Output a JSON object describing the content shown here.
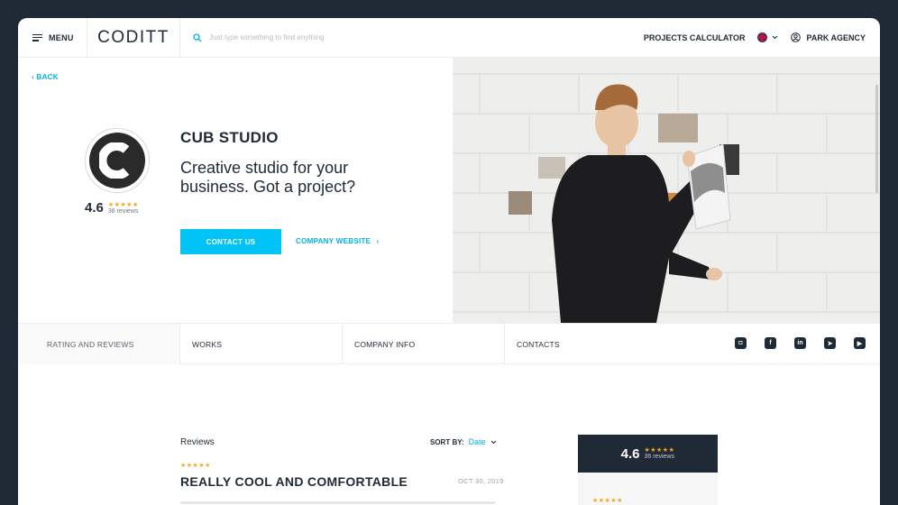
{
  "header": {
    "menu_label": "MENU",
    "logo_text": "CODITT",
    "search_placeholder": "Just type something to find enything",
    "projects_calculator": "PROJECTS CALCULATOR",
    "agency_label": "PARK AGENCY"
  },
  "hero": {
    "back_label": "BACK",
    "rating": "4.6",
    "stars": "★★★★★",
    "reviews_count": "36 reviews",
    "company_name": "CUB STUDIO",
    "tagline": "Creative studio for your business. Got a project?",
    "contact_button": "CONTACT US",
    "website_link": "COMPANY WEBSITE",
    "website_arrow": "›"
  },
  "tabs": [
    {
      "label": "RATING AND REVIEWS"
    },
    {
      "label": "WORKS"
    },
    {
      "label": "COMPANY INFO"
    },
    {
      "label": "CONTACTS"
    }
  ],
  "social": {
    "instagram": "◘",
    "facebook": "f",
    "linkedin": "in",
    "telegram": "➤",
    "youtube": "▶"
  },
  "reviews": {
    "title": "Reviews",
    "sort_label": "SORT BY:",
    "sort_value": "Date",
    "items": [
      {
        "stars": "★★★★★",
        "title": "REALLY COOL AND COMFORTABLE",
        "date": "OCT 30, 2019"
      }
    ]
  },
  "summary": {
    "rating": "4.6",
    "stars": "★★★★★",
    "reviews_count": "36 reviews",
    "side_stars": "★★★★★"
  },
  "colors": {
    "accent": "#00c4f5",
    "dark": "#1f2a36",
    "star": "#f5a623"
  }
}
